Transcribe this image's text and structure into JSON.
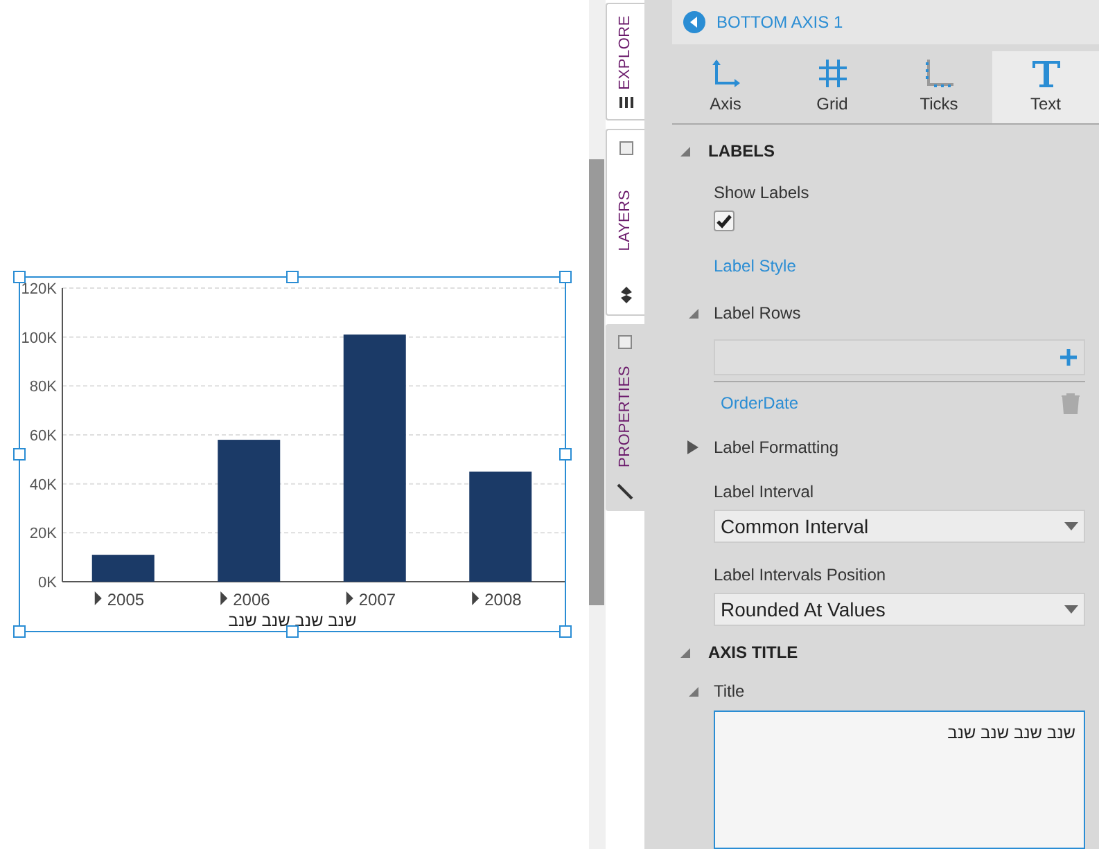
{
  "chart": {
    "chart_data": {
      "type": "bar",
      "grid": true,
      "categories": [
        "2005",
        "2006",
        "2007",
        "2008"
      ],
      "series": [
        {
          "color": "#1b3a67",
          "values": [
            11000,
            58000,
            101000,
            45000
          ]
        }
      ],
      "ylim": [
        0,
        120000
      ],
      "yticks": [
        {
          "value": 0,
          "label": "0K"
        },
        {
          "value": 20000,
          "label": "20K"
        },
        {
          "value": 40000,
          "label": "40K"
        },
        {
          "value": 60000,
          "label": "60K"
        },
        {
          "value": 80000,
          "label": "80K"
        },
        {
          "value": 100000,
          "label": "100K"
        },
        {
          "value": 120000,
          "label": "120K"
        }
      ],
      "xlabel": "שנב שנב שנב שנב"
    }
  },
  "side_tabs": [
    {
      "label": "EXPLORE",
      "selected": false
    },
    {
      "label": "LAYERS",
      "selected": false
    },
    {
      "label": "PROPERTIES",
      "selected": true
    }
  ],
  "panel": {
    "back_title": "BOTTOM AXIS 1",
    "tabs": [
      {
        "label": "Axis",
        "kind": "axis",
        "selected": false
      },
      {
        "label": "Grid",
        "kind": "grid",
        "selected": false
      },
      {
        "label": "Ticks",
        "kind": "ticks",
        "selected": false
      },
      {
        "label": "Text",
        "kind": "text",
        "selected": true
      }
    ],
    "labels_section": {
      "heading": "LABELS",
      "expanded": true,
      "show_labels": {
        "label": "Show Labels",
        "checked": true
      },
      "label_style": "Label Style",
      "label_rows": {
        "label": "Label Rows",
        "expanded": true,
        "rows": [
          "OrderDate"
        ]
      },
      "label_formatting": {
        "label": "Label Formatting",
        "expanded": false
      },
      "label_interval": {
        "label": "Label Interval",
        "value": "Common Interval"
      },
      "label_intervals_position": {
        "label": "Label Intervals Position",
        "value": "Rounded At Values"
      }
    },
    "axis_title_section": {
      "heading": "AXIS TITLE",
      "expanded": true,
      "title": {
        "label": "Title",
        "expanded": true,
        "value": "שנב שנב שנב שנב"
      }
    }
  }
}
